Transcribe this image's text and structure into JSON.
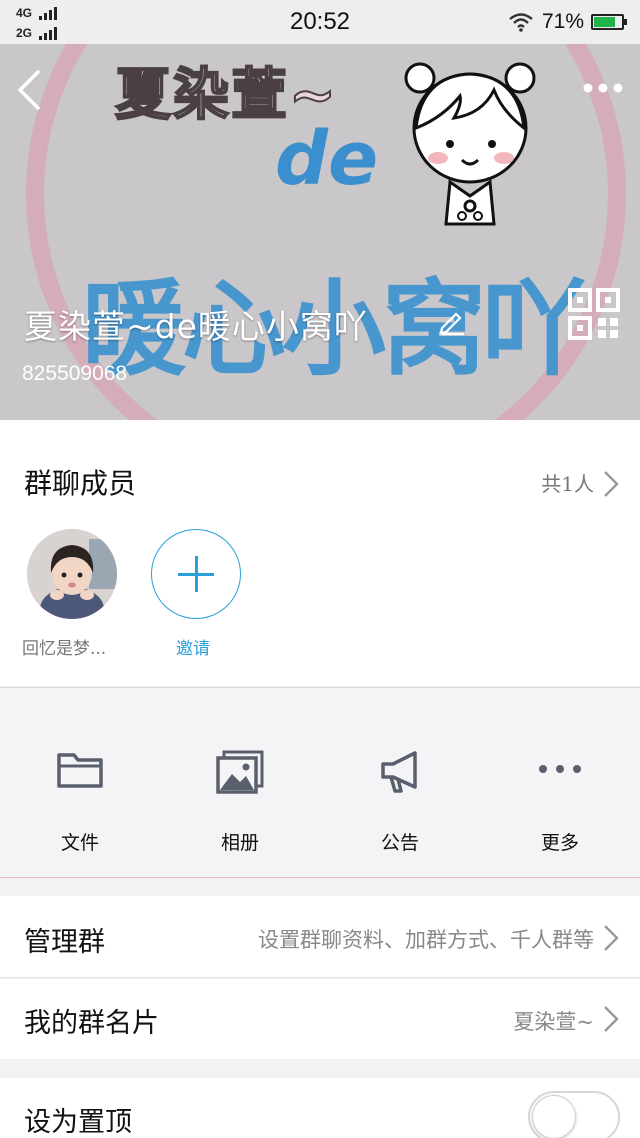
{
  "status_bar": {
    "network_1": "4G",
    "network_2": "2G",
    "time": "20:52",
    "battery": "71%",
    "battery_level": 0.71,
    "battery_color": "#1fb54a"
  },
  "header": {
    "banner_title": "夏染萱~",
    "banner_de": "de",
    "banner_big": "暖心小窝吖",
    "group_name": "夏染萱~de暖心小窝吖",
    "group_id": "825509068",
    "icons": [
      "back-icon",
      "more-icon",
      "edit-icon",
      "qr-code-icon"
    ]
  },
  "members": {
    "title": "群聊成员",
    "count": "共1人",
    "list": [
      {
        "name": "回忆是梦..."
      }
    ],
    "invite_label": "邀请",
    "accent": "#2a9fd8"
  },
  "actions": [
    {
      "label": "文件",
      "icon": "folder-icon"
    },
    {
      "label": "相册",
      "icon": "photo-album-icon"
    },
    {
      "label": "公告",
      "icon": "megaphone-icon"
    },
    {
      "label": "更多",
      "icon": "more-dots-icon"
    }
  ],
  "settings": {
    "manage_label": "管理群",
    "manage_value": "设置群聊资料、加群方式、千人群等",
    "card_label": "我的群名片",
    "card_value": "夏染萱~",
    "pin_label": "设为置顶",
    "pin_enabled": false
  }
}
